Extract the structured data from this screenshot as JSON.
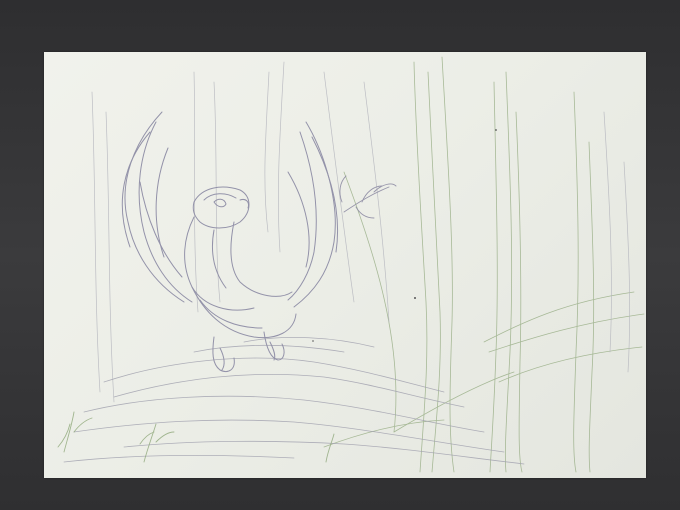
{
  "scene": {
    "subject": "pencil-sketch-bird-in-forest",
    "colors": {
      "backdrop": "#3a3a3c",
      "paper": "#eceee7",
      "pencil_graphite": "#8a8a9a",
      "pencil_blue": "#9a98b0",
      "pencil_green": "#8fa87a"
    }
  }
}
